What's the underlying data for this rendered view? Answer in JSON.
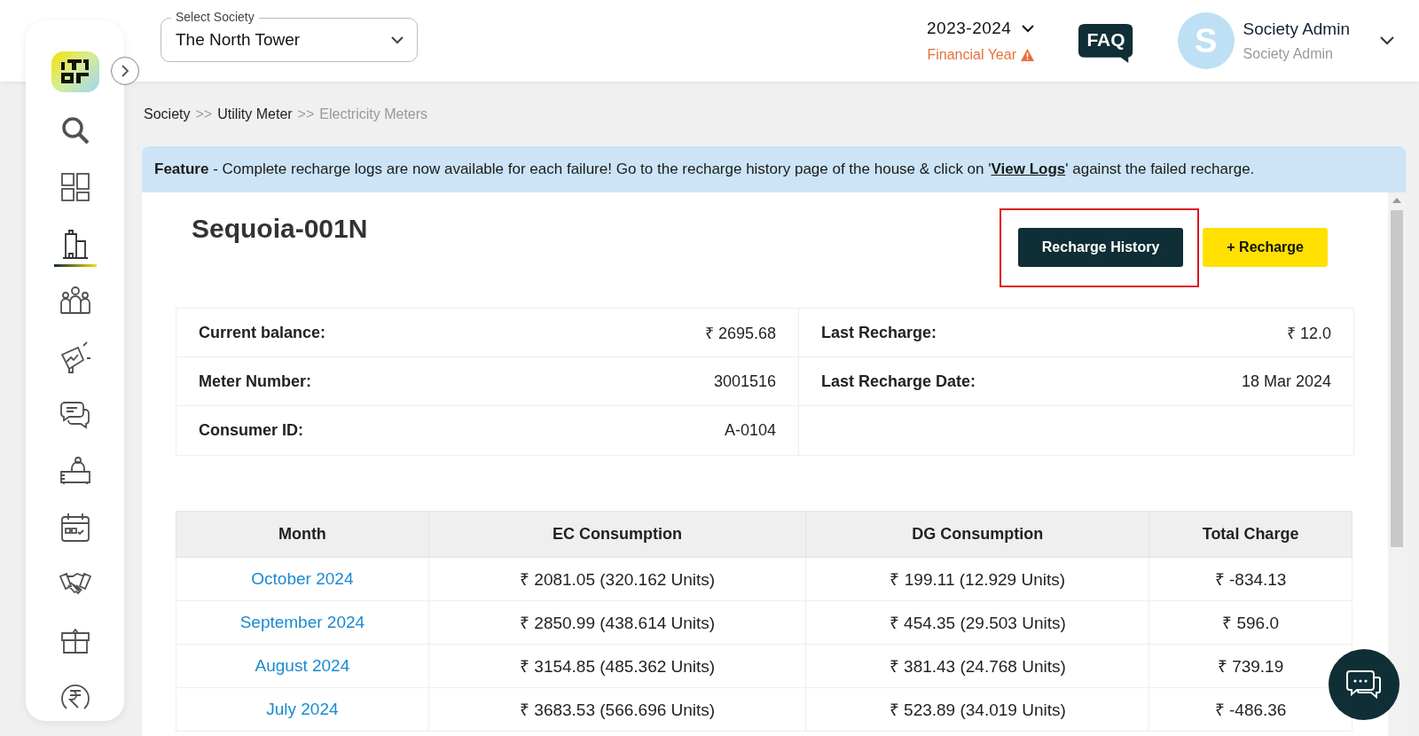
{
  "sidebar": {
    "items": [
      {
        "kind": "search",
        "selected": false
      },
      {
        "kind": "dashboard",
        "selected": false
      },
      {
        "kind": "building",
        "selected": true
      },
      {
        "kind": "people",
        "selected": false
      },
      {
        "kind": "megaphone",
        "selected": false
      },
      {
        "kind": "chat",
        "selected": false
      },
      {
        "kind": "desk",
        "selected": false
      },
      {
        "kind": "calendar",
        "selected": false
      },
      {
        "kind": "handshake",
        "selected": false
      },
      {
        "kind": "box",
        "selected": false
      },
      {
        "kind": "rupee",
        "selected": false
      }
    ]
  },
  "header": {
    "society_select": {
      "label": "Select Society",
      "value": "The North Tower"
    },
    "year": {
      "value": "2023-2024",
      "caption": "Financial Year"
    },
    "faq": "FAQ",
    "user": {
      "initial": "S",
      "name": "Society Admin",
      "role": "Society Admin"
    }
  },
  "breadcrumb": [
    {
      "label": "Society",
      "current": false
    },
    {
      "label": "Utility Meter",
      "current": false
    },
    {
      "label": "Electricity Meters",
      "current": true
    }
  ],
  "breadcrumb_separator": ">>",
  "banner": {
    "text": "**Feature** - Complete recharge logs are now available for each failure! Go to the recharge history page of the house & click on '",
    "link": "View Logs",
    "suffix": "' against the failed recharge."
  },
  "meter": {
    "title": "Sequoia-001N",
    "buttons": [
      {
        "label": "Recharge History",
        "kind": "dark",
        "highlighted": true
      },
      {
        "label": "+ Recharge",
        "kind": "yellow",
        "highlighted": false
      }
    ],
    "info": [
      {
        "label": "Current balance:",
        "value": "₹ 2695.68"
      },
      {
        "label": "Last Recharge:",
        "value": "₹ 12.0"
      },
      {
        "label": "Meter Number:",
        "value": "3001516"
      },
      {
        "label": "Last Recharge Date:",
        "value": "18 Mar 2024"
      },
      {
        "label": "Consumer ID:",
        "value": "A-0104"
      }
    ]
  },
  "table": {
    "columns": [
      "Month",
      "EC Consumption",
      "DG Consumption",
      "Total Charge"
    ],
    "rows": [
      [
        "October 2024",
        "₹ 2081.05 (320.162 Units)",
        "₹ 199.11 (12.929 Units)",
        "₹ -834.13"
      ],
      [
        "September 2024",
        "₹ 2850.99 (438.614 Units)",
        "₹ 454.35 (29.503 Units)",
        "₹ 596.0"
      ],
      [
        "August 2024",
        "₹ 3154.85 (485.362 Units)",
        "₹ 381.43 (24.768 Units)",
        "₹ 739.19"
      ],
      [
        "July 2024",
        "₹ 3683.53 (566.696 Units)",
        "₹ 523.89 (34.019 Units)",
        "₹ -486.36"
      ]
    ]
  }
}
